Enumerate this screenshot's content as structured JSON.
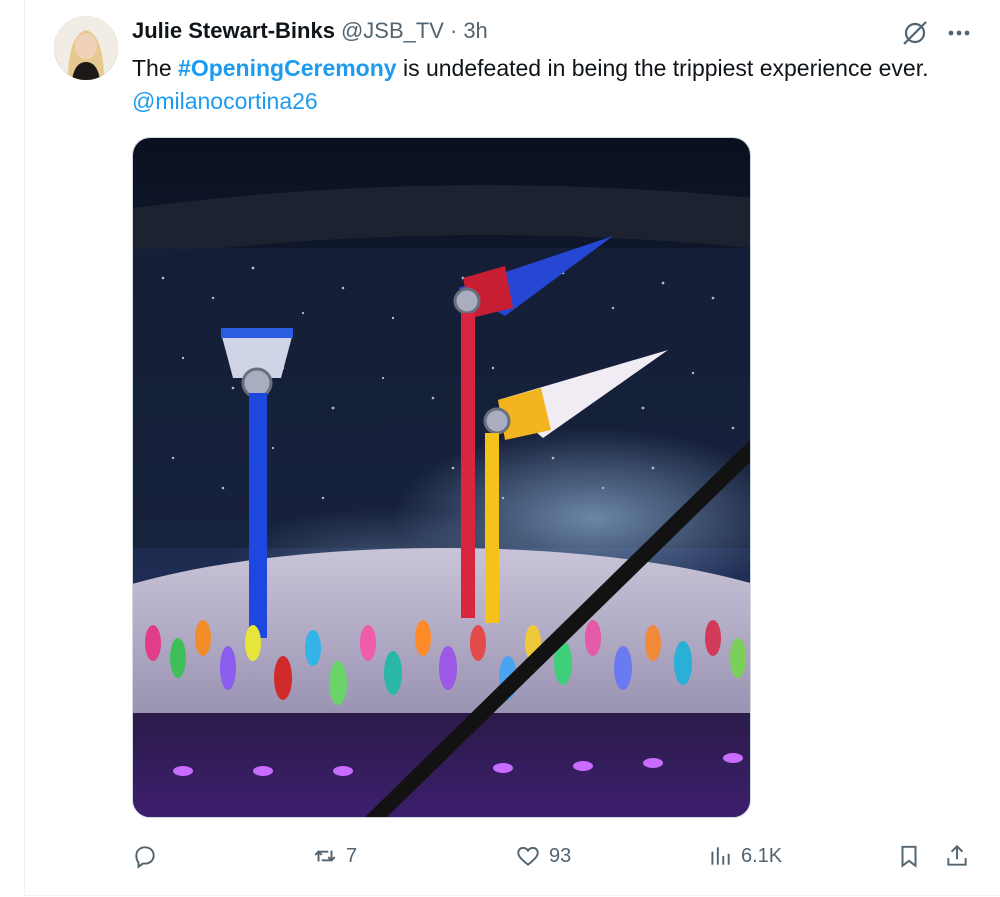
{
  "author": {
    "name": "Julie Stewart-Binks",
    "handle": "@JSB_TV",
    "separator": "·",
    "time": "3h"
  },
  "post": {
    "text_prefix": "The ",
    "hashtag": "#OpeningCeremony",
    "text_middle": " is undefeated in being the trippiest experience ever. ",
    "mention": "@milanocortina26"
  },
  "actions": {
    "replies": "",
    "reposts": "7",
    "likes": "93",
    "views": "6.1K"
  },
  "icons": {
    "header": [
      "grok-icon",
      "more-icon"
    ],
    "actions": [
      "reply-icon",
      "repost-icon",
      "like-icon",
      "views-icon",
      "bookmark-icon",
      "share-icon"
    ]
  },
  "colors": {
    "link": "#1d9bf0",
    "muted": "#536471",
    "text": "#0f1419"
  }
}
